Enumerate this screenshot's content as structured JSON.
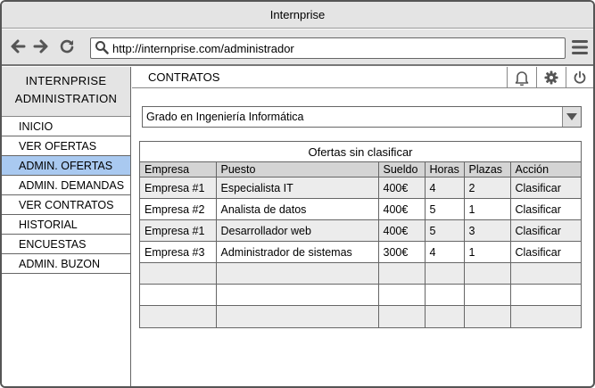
{
  "window": {
    "title": "Internprise"
  },
  "browser": {
    "url": "http://internprise.com/administrador"
  },
  "icons": {
    "back": "arrow-left-icon",
    "forward": "arrow-right-icon",
    "reload": "reload-icon",
    "search": "search-icon",
    "menu": "hamburger-menu-icon",
    "bell": "bell-icon",
    "gear": "gear-icon",
    "power": "power-icon",
    "dropdown": "chevron-down-icon"
  },
  "sidebar": {
    "header_line1": "INTERNPRISE",
    "header_line2": "ADMINISTRATION",
    "items": [
      {
        "label": "INICIO",
        "active": false
      },
      {
        "label": "VER OFERTAS",
        "active": false
      },
      {
        "label": "ADMIN. OFERTAS",
        "active": true
      },
      {
        "label": "ADMIN. DEMANDAS",
        "active": false
      },
      {
        "label": "VER CONTRATOS",
        "active": false
      },
      {
        "label": "HISTORIAL",
        "active": false
      },
      {
        "label": "ENCUESTAS",
        "active": false
      },
      {
        "label": "ADMIN. BUZON",
        "active": false
      }
    ],
    "active_color": "#a9c9f0"
  },
  "main": {
    "section_title": "CONTRATOS",
    "degree_select": {
      "value": "Grado en Ingeniería Informática"
    },
    "table": {
      "caption": "Ofertas sin clasificar",
      "columns": [
        "Empresa",
        "Puesto",
        "Sueldo",
        "Horas",
        "Plazas",
        "Acción"
      ],
      "rows": [
        [
          "Empresa #1",
          "Especialista IT",
          "400€",
          "4",
          "2",
          "Clasificar"
        ],
        [
          "Empresa #2",
          "Analista de datos",
          "400€",
          "5",
          "1",
          "Clasificar"
        ],
        [
          "Empresa #1",
          "Desarrollador web",
          "400€",
          "5",
          "3",
          "Clasificar"
        ],
        [
          "Empresa #3",
          "Administrador de sistemas",
          "300€",
          "4",
          "1",
          "Clasificar"
        ],
        [
          "",
          "",
          "",
          "",
          "",
          ""
        ],
        [
          "",
          "",
          "",
          "",
          "",
          ""
        ],
        [
          "",
          "",
          "",
          "",
          "",
          ""
        ]
      ]
    }
  }
}
